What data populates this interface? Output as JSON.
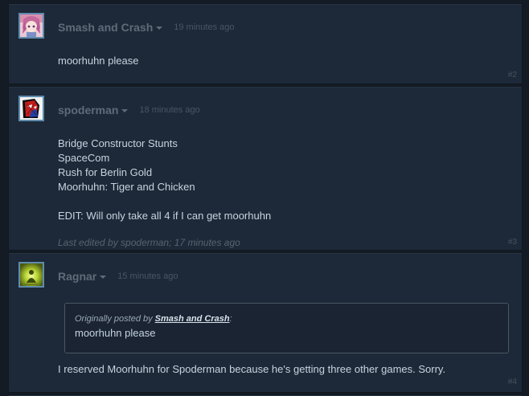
{
  "posts": [
    {
      "author": "Smash and Crash",
      "timestamp": "19 minutes ago",
      "avatar": "anime-girl-avatar",
      "lines": [
        "moorhuhn please"
      ],
      "post_number": "#2"
    },
    {
      "author": "spoderman",
      "timestamp": "18 minutes ago",
      "avatar": "spiderman-mask-avatar",
      "lines": [
        "Bridge Constructor Stunts",
        "SpaceCom",
        "Rush for Berlin Gold",
        "Moorhuhn: Tiger and Chicken",
        "",
        "EDIT: Will only take all 4 if I can get moorhuhn"
      ],
      "edited_note": "Last edited by spoderman; 17 minutes ago",
      "post_number": "#3"
    },
    {
      "author": "Ragnar",
      "timestamp": "15 minutes ago",
      "avatar": "green-glow-avatar",
      "quote": {
        "prefix": "Originally posted by ",
        "author": "Smash and Crash",
        "suffix": ":",
        "text": "moorhuhn please"
      },
      "lines": [
        "I reserved Moorhuhn for Spoderman because he's getting three other games. Sorry."
      ],
      "post_number": "#4"
    }
  ],
  "colors": {
    "background": "#141b24",
    "post_background": "#1d2938",
    "author_name": "#5e6b79",
    "body_text": "#c6d4df",
    "avatar_border": "#5f8cae"
  }
}
